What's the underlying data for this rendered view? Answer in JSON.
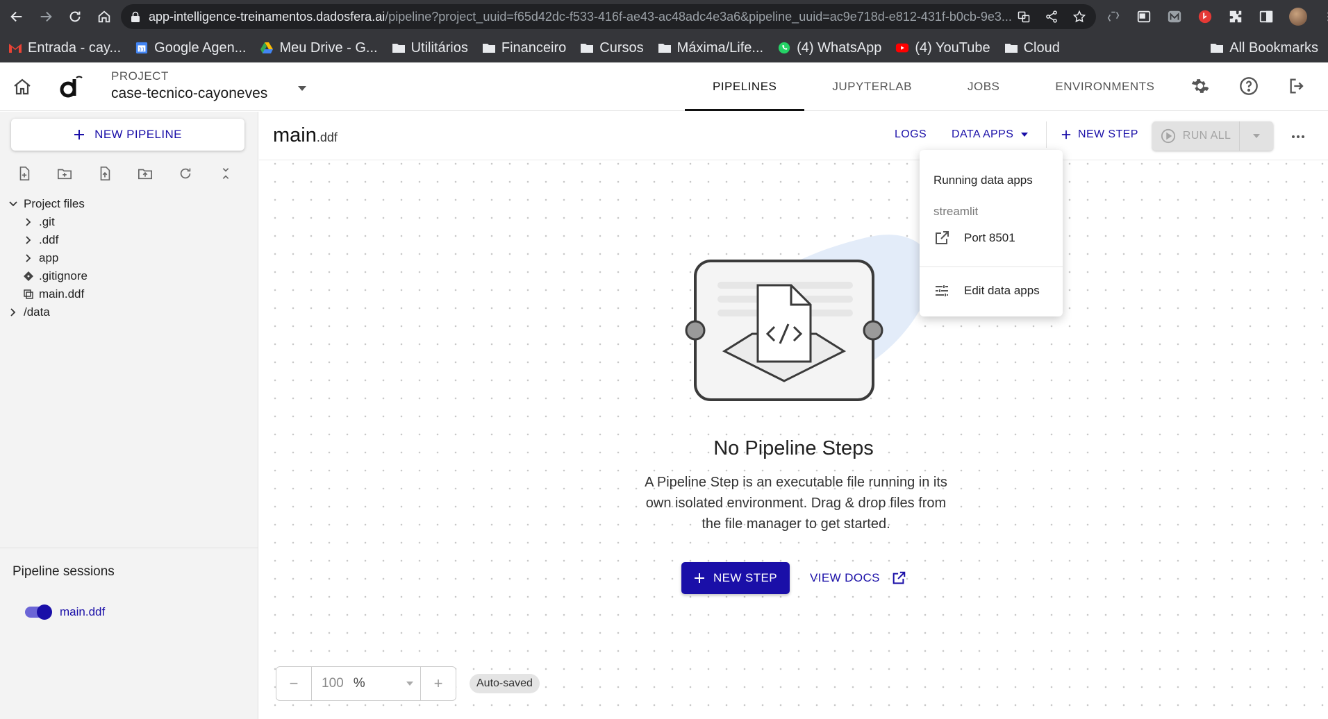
{
  "browser": {
    "url_host": "app-intelligence-treinamentos.dadosfera.ai",
    "url_path": "/pipeline?project_uuid=f65d42dc-f533-416f-ae43-ac48adc4e3a6&pipeline_uuid=ac9e718d-e812-431f-b0cb-9e3...",
    "bookmarks": [
      {
        "label": "Entrada - cay..."
      },
      {
        "label": "Google Agen..."
      },
      {
        "label": "Meu Drive - G..."
      },
      {
        "label": "Utilitários"
      },
      {
        "label": "Financeiro"
      },
      {
        "label": "Cursos"
      },
      {
        "label": "Máxima/Life..."
      },
      {
        "label": "(4) WhatsApp"
      },
      {
        "label": "(4) YouTube"
      },
      {
        "label": "Cloud"
      }
    ],
    "all_bookmarks": "All Bookmarks"
  },
  "header": {
    "project_label": "PROJECT",
    "project_name": "case-tecnico-cayoneves",
    "tabs": [
      {
        "label": "PIPELINES"
      },
      {
        "label": "JUPYTERLAB"
      },
      {
        "label": "JOBS"
      },
      {
        "label": "ENVIRONMENTS"
      }
    ]
  },
  "sidebar": {
    "new_pipeline": "NEW PIPELINE",
    "tree": {
      "root": "Project files",
      "items": [
        {
          "label": ".git"
        },
        {
          "label": ".ddf"
        },
        {
          "label": "app"
        },
        {
          "label": ".gitignore"
        },
        {
          "label": "main.ddf"
        }
      ],
      "data": "/data"
    },
    "sessions_title": "Pipeline sessions",
    "session_name": "main.ddf"
  },
  "toolbar": {
    "title_main": "main",
    "title_ext": ".ddf",
    "logs": "LOGS",
    "data_apps": "DATA APPS",
    "new_step": "NEW STEP",
    "run_all": "RUN ALL"
  },
  "dropdown": {
    "heading": "Running data apps",
    "app_name": "streamlit",
    "port": "Port 8501",
    "edit": "Edit data apps"
  },
  "empty_state": {
    "title": "No Pipeline Steps",
    "description": "A Pipeline Step is an executable file running in its own isolated environment. Drag & drop files from the file manager to get started.",
    "new_step": "NEW STEP",
    "view_docs": "VIEW DOCS"
  },
  "zoom": {
    "value": "100",
    "unit": "%",
    "minus": "−",
    "plus": "+"
  },
  "status": {
    "autosaved": "Auto-saved"
  },
  "colors": {
    "accent": "#1a0fa8",
    "chrome_bg": "#35363a"
  }
}
